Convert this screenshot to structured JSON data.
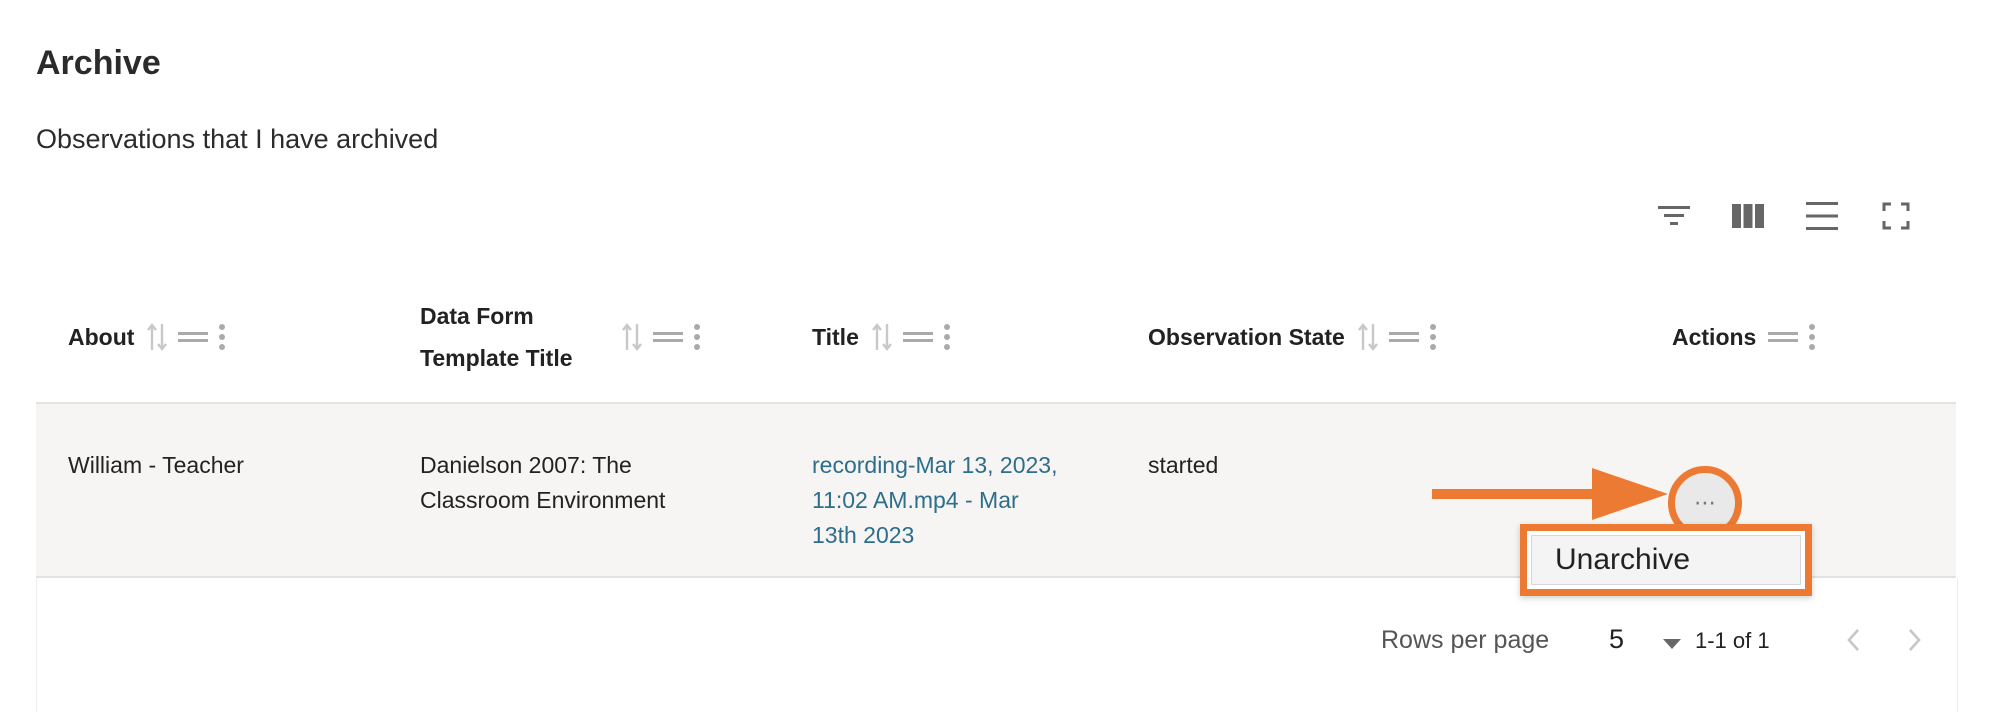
{
  "page": {
    "title": "Archive",
    "subtitle": "Observations that I have archived"
  },
  "toolbar": {
    "icons": [
      "filter-icon",
      "columns-icon",
      "density-icon",
      "fullscreen-icon"
    ]
  },
  "table": {
    "columns": [
      {
        "line1": "About",
        "line2": ""
      },
      {
        "line1": "Data Form",
        "line2": "Template Title"
      },
      {
        "line1": "Title",
        "line2": ""
      },
      {
        "line1": "Observation State",
        "line2": ""
      },
      {
        "line1": "Actions",
        "line2": ""
      }
    ],
    "rows": [
      {
        "about": "William - Teacher",
        "template_title_1": "Danielson 2007: The",
        "template_title_2": "Classroom Environment",
        "title_1": "recording-Mar 13, 2023,",
        "title_2": "11:02 AM.mp4 - Mar",
        "title_3": "13th 2023",
        "state": "started",
        "action_glyph": "⋯"
      }
    ]
  },
  "menu": {
    "unarchive_label": "Unarchive"
  },
  "pagination": {
    "rows_per_page_label": "Rows per page",
    "rows_per_page_value": "5",
    "range_text": "1-1 of 1"
  },
  "colors": {
    "accent": "#ec7a33",
    "link": "#2d6e8a",
    "row_bg": "#f6f5f3"
  }
}
